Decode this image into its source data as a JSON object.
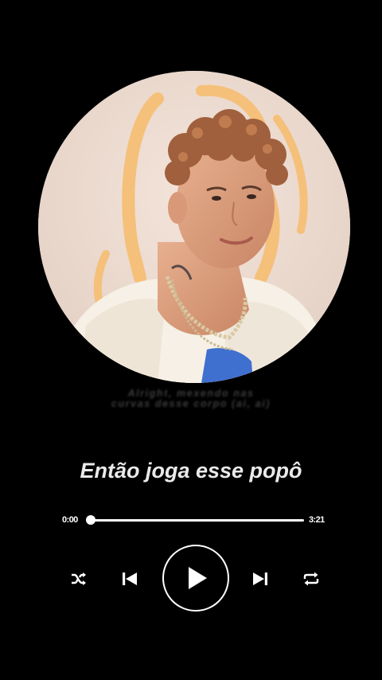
{
  "player": {
    "ghost_lyric_line1": "Alright, mexendo nas",
    "ghost_lyric_line2": "curvas desse corpo (ai, ai)",
    "current_lyric": "Então joga esse popô",
    "time_current": "0:00",
    "time_total": "3:21",
    "progress_fraction": 0.0
  },
  "controls": {
    "shuffle_icon": "shuffle-icon",
    "previous_icon": "skip-previous-icon",
    "play_icon": "play-icon",
    "next_icon": "skip-next-icon",
    "repeat_icon": "repeat-icon"
  },
  "colors": {
    "background": "#000000",
    "foreground": "#ffffff",
    "art_background": "#ead8cd",
    "art_graphic": "#f5c07a"
  }
}
